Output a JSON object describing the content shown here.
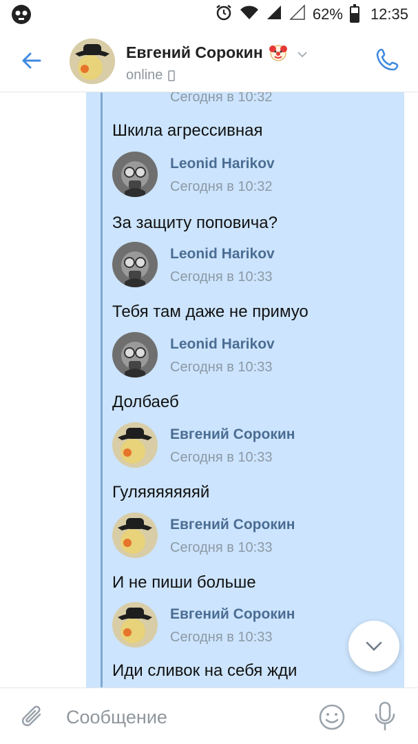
{
  "status_bar": {
    "battery_percent": "62%",
    "battery_level": 0.62,
    "time": "12:35"
  },
  "header": {
    "contact_name": "Евгений Сорокин",
    "status": "online"
  },
  "messages": [
    {
      "time": "Сегодня в 10:32",
      "text": "Шкила агрессивная"
    },
    {
      "author": "Leonid Harikov",
      "time": "Сегодня в 10:32",
      "text": "За защиту поповича?"
    },
    {
      "author": "Leonid Harikov",
      "time": "Сегодня в 10:33",
      "text": "Тебя там даже не примуо"
    },
    {
      "author": "Leonid Harikov",
      "time": "Сегодня в 10:33",
      "text": "Долбаеб"
    },
    {
      "author": "Евгений Сорокин",
      "time": "Сегодня в 10:33",
      "text": "Гуляяяяяяяй"
    },
    {
      "author": "Евгений Сорокин",
      "time": "Сегодня в 10:33",
      "text": "И не пиши больше"
    },
    {
      "author": "Евгений Сорокин",
      "time": "Сегодня в 10:33",
      "text": "Иди сливок на себя жди"
    }
  ],
  "composer": {
    "placeholder": "Сообщение"
  },
  "colors": {
    "accent": "#3f8ae0",
    "bubble": "#cce4fd",
    "author": "#4b6d93",
    "quote_bar": "#7fa8d2"
  },
  "icons": [
    "skull-icon",
    "alarm-icon",
    "wifi-icon",
    "signal-icon",
    "battery-icon",
    "back-arrow-icon",
    "clown-icon",
    "chevron-down-icon",
    "mobile-icon",
    "phone-icon",
    "paperclip-icon",
    "emoji-icon",
    "microphone-icon"
  ]
}
